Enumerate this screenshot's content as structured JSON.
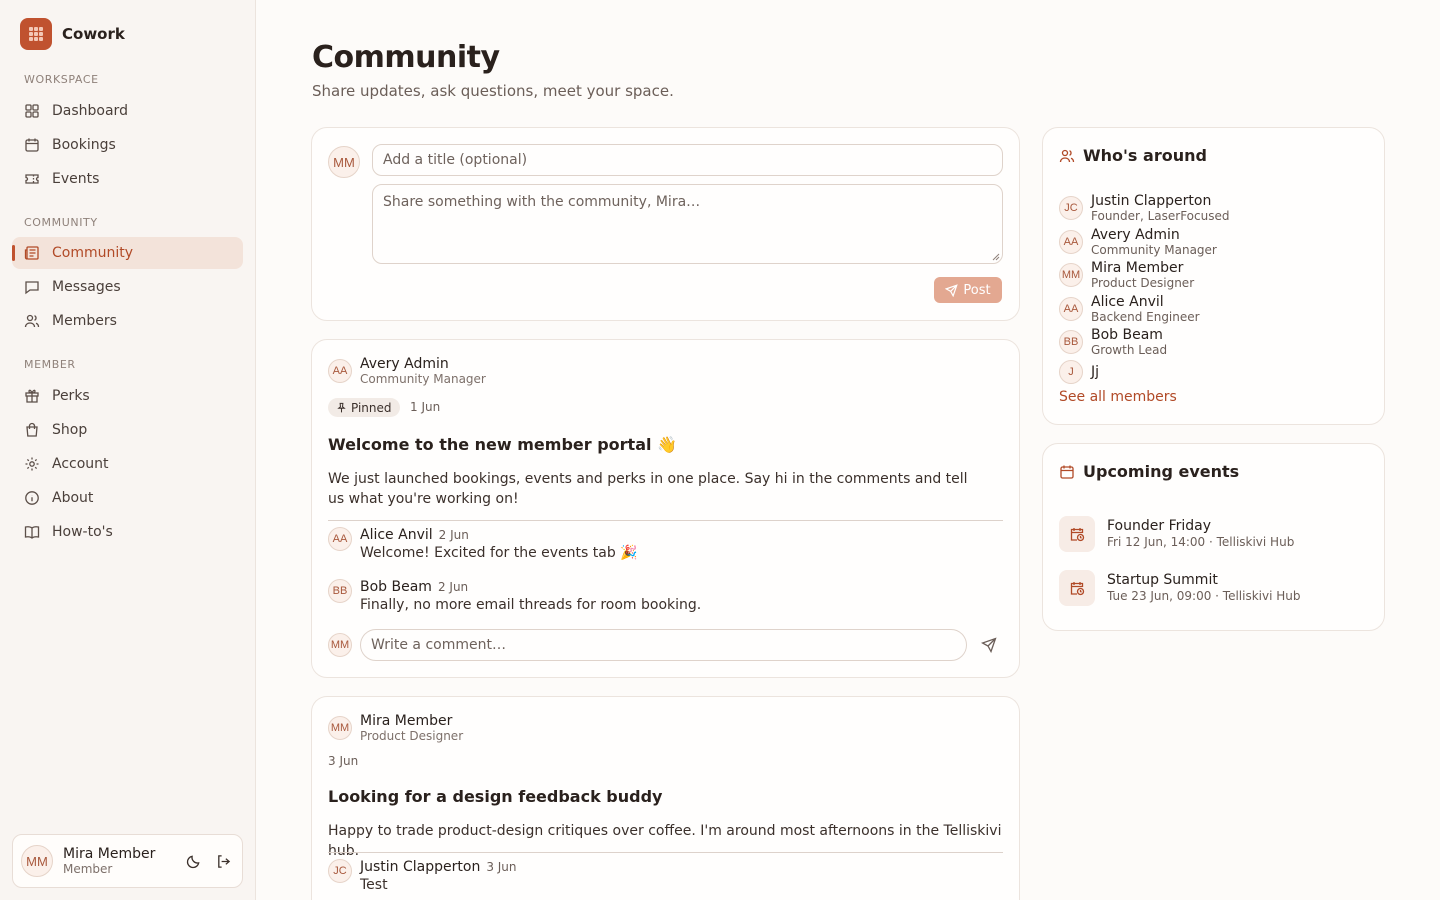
{
  "app": {
    "name": "Cowork"
  },
  "nav": {
    "workspace_label": "WORKSPACE",
    "community_label": "COMMUNITY",
    "member_label": "MEMBER",
    "items": [
      {
        "label": "Dashboard",
        "icon": "dashboard-icon"
      },
      {
        "label": "Bookings",
        "icon": "calendar-icon"
      },
      {
        "label": "Events",
        "icon": "ticket-icon"
      },
      {
        "label": "Community",
        "icon": "newspaper-icon",
        "active": true
      },
      {
        "label": "Messages",
        "icon": "message-icon"
      },
      {
        "label": "Members",
        "icon": "users-icon"
      },
      {
        "label": "Perks",
        "icon": "gift-icon"
      },
      {
        "label": "Shop",
        "icon": "shopping-bag-icon"
      },
      {
        "label": "Account",
        "icon": "gear-icon"
      },
      {
        "label": "About",
        "icon": "info-icon"
      },
      {
        "label": "How-to's",
        "icon": "book-icon"
      }
    ]
  },
  "current_user": {
    "initials": "MM",
    "name": "Mira Member",
    "role": "Member"
  },
  "page": {
    "title": "Community",
    "subtitle": "Share updates, ask questions, meet your space."
  },
  "composer": {
    "title_placeholder": "Add a title (optional)",
    "body_placeholder": "Share something with the community, Mira…",
    "post_label": "Post"
  },
  "posts": [
    {
      "author": {
        "initials": "AA",
        "name": "Avery Admin",
        "role": "Community Manager"
      },
      "pinned_label": "Pinned",
      "date": "1 Jun",
      "title": "Welcome to the new member portal 👋",
      "body": "We just launched bookings, events and perks in one place. Say hi in the comments and tell us what you're working on!",
      "comments": [
        {
          "initials": "AA",
          "name": "Alice Anvil",
          "date": "2 Jun",
          "text": "Welcome! Excited for the events tab 🎉"
        },
        {
          "initials": "BB",
          "name": "Bob Beam",
          "date": "2 Jun",
          "text": "Finally, no more email threads for room booking."
        }
      ],
      "comment_placeholder": "Write a comment…"
    },
    {
      "author": {
        "initials": "MM",
        "name": "Mira Member",
        "role": "Product Designer"
      },
      "date": "3 Jun",
      "title": "Looking for a design feedback buddy",
      "body": "Happy to trade product-design critiques over coffee. I'm around most afternoons in the Telliskivi hub.",
      "comments": [
        {
          "initials": "JC",
          "name": "Justin Clapperton",
          "date": "3 Jun",
          "text": "Test"
        }
      ]
    }
  ],
  "whos_around": {
    "title": "Who's around",
    "members": [
      {
        "initials": "JC",
        "name": "Justin Clapperton",
        "role": "Founder, LaserFocused"
      },
      {
        "initials": "AA",
        "name": "Avery Admin",
        "role": "Community Manager"
      },
      {
        "initials": "MM",
        "name": "Mira Member",
        "role": "Product Designer"
      },
      {
        "initials": "AA",
        "name": "Alice Anvil",
        "role": "Backend Engineer"
      },
      {
        "initials": "BB",
        "name": "Bob Beam",
        "role": "Growth Lead"
      },
      {
        "initials": "J",
        "name": "Jj",
        "role": ""
      }
    ],
    "see_all_label": "See all members"
  },
  "upcoming_events": {
    "title": "Upcoming events",
    "events": [
      {
        "name": "Founder Friday",
        "meta": "Fri 12 Jun, 14:00 · Telliskivi Hub"
      },
      {
        "name": "Startup Summit",
        "meta": "Tue 23 Jun, 09:00 · Telliskivi Hub"
      }
    ]
  },
  "colors": {
    "accent": "#c0522f",
    "active_bg": "#f3e3da",
    "post_button": "#e3a891"
  }
}
